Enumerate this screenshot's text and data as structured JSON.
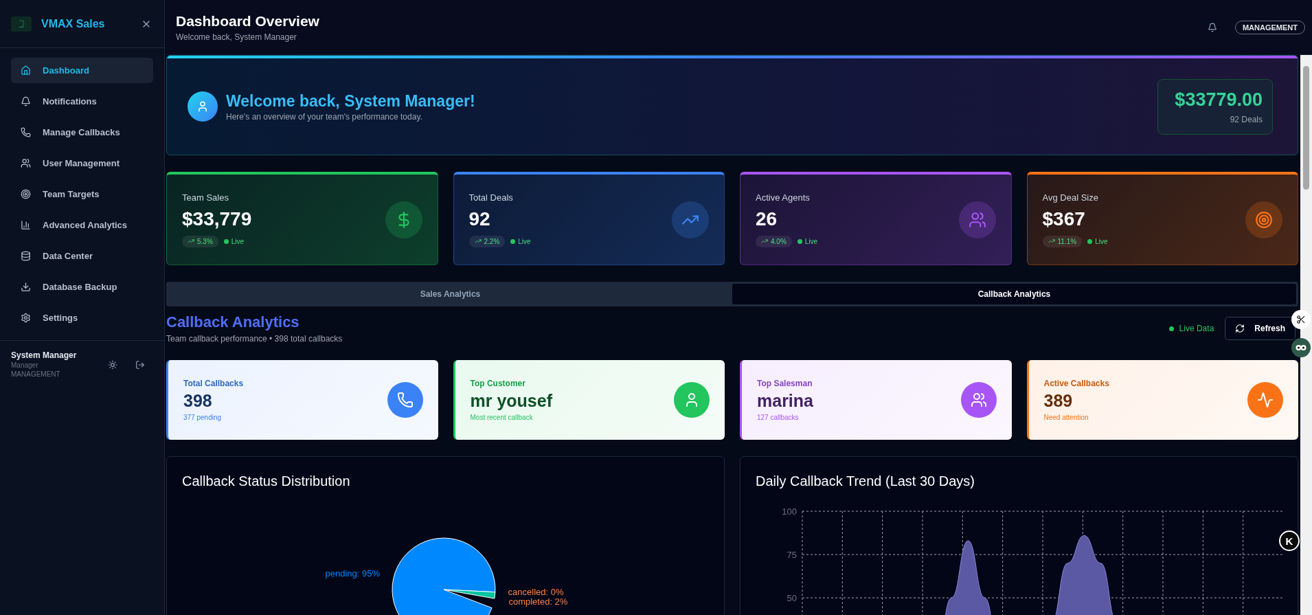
{
  "sidebar": {
    "brand": "VMAX Sales",
    "items": [
      {
        "label": "Dashboard",
        "selected": true
      },
      {
        "label": "Notifications",
        "selected": false
      },
      {
        "label": "Manage Callbacks",
        "selected": false
      },
      {
        "label": "User Management",
        "selected": false
      },
      {
        "label": "Team Targets",
        "selected": false
      },
      {
        "label": "Advanced Analytics",
        "selected": false
      },
      {
        "label": "Data Center",
        "selected": false
      },
      {
        "label": "Database Backup",
        "selected": false
      },
      {
        "label": "Settings",
        "selected": false
      }
    ],
    "user": {
      "name": "System Manager",
      "role": "Manager",
      "group": "MANAGEMENT"
    }
  },
  "header": {
    "title": "Dashboard Overview",
    "subtitle": "Welcome back, System Manager",
    "badge": "MANAGEMENT"
  },
  "banner": {
    "title": "Welcome back, System Manager!",
    "subtitle": "Here's an overview of your team's performance today.",
    "amount": "$33779.00",
    "deals": "92 Deals"
  },
  "kpis": [
    {
      "label": "Team Sales",
      "value": "$33,779",
      "change": "5.3%",
      "status": "Live",
      "color": "#22c55e"
    },
    {
      "label": "Total Deals",
      "value": "92",
      "change": "2.2%",
      "status": "Live",
      "color": "#3b82f6"
    },
    {
      "label": "Active Agents",
      "value": "26",
      "change": "4.0%",
      "status": "Live",
      "color": "#a855f7"
    },
    {
      "label": "Avg Deal Size",
      "value": "$367",
      "change": "11.1%",
      "status": "Live",
      "color": "#f97316"
    }
  ],
  "tabs": [
    {
      "label": "Sales Analytics",
      "selected": false
    },
    {
      "label": "Callback Analytics",
      "selected": true
    }
  ],
  "callbacks": {
    "title": "Callback Analytics",
    "subtitle": "Team callback performance • 398 total callbacks",
    "live": "Live Data",
    "refresh": "Refresh",
    "cards": [
      {
        "label": "Total Callbacks",
        "value": "398",
        "note": "377 pending",
        "color": "#3b82f6"
      },
      {
        "label": "Top Customer",
        "value": "mr yousef",
        "note": "Most recent callback",
        "color": "#22c55e"
      },
      {
        "label": "Top Salesman",
        "value": "marina",
        "note": "127 callbacks",
        "color": "#a855f7"
      },
      {
        "label": "Active Callbacks",
        "value": "389",
        "note": "Need attention",
        "color": "#f97316"
      }
    ]
  },
  "charts": [
    {
      "title": "Callback Status Distribution",
      "chart_data": {
        "type": "pie",
        "values": [
          95,
          2,
          0
        ],
        "value_labels": [
          "pending: 95%",
          "completed: 2%",
          "cancelled: 0%"
        ]
      }
    },
    {
      "title": "Daily Callback Trend (Last 30 Days)",
      "chart_data": {
        "type": "area",
        "grid": true,
        "ylim": [
          0,
          100
        ],
        "yticks": [
          50,
          75,
          100
        ],
        "values": [
          0,
          0,
          0,
          0,
          0,
          0,
          0,
          0,
          10,
          50,
          83,
          50,
          10,
          0,
          10,
          35,
          70,
          86,
          70,
          35,
          10,
          0,
          0,
          0,
          0,
          0,
          0,
          0,
          0,
          0
        ]
      }
    }
  ],
  "extension_badge": "K"
}
